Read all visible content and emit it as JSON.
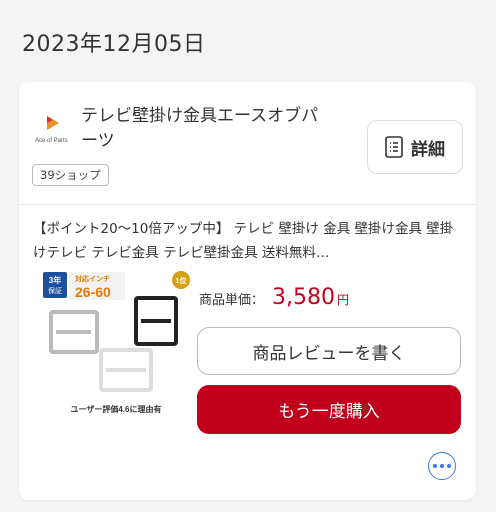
{
  "order_date": "2023年12月05日",
  "shop": {
    "name": "テレビ壁掛け金具エースオブパーツ",
    "logo_text": "Ace of Parts",
    "badge": "39ショップ",
    "detail_button": "詳細",
    "detail_icon": "list-document-icon"
  },
  "product": {
    "description": "【ポイント20〜10倍アップ中】 テレビ 壁掛け 金具 壁掛け金具 壁掛けテレビ テレビ金具 テレビ壁掛金具 送料無料…",
    "image_text": {
      "warranty_top": "3年",
      "warranty_bottom": "保証",
      "inch_label": "対応インチ",
      "inch_range": "26-60",
      "rank_badge": "1位",
      "rating_caption": "ユーザー評価4.6に理由有"
    },
    "price_label": "商品単価：",
    "price_value": "3,580",
    "price_unit": "円"
  },
  "actions": {
    "review_button": "商品レビューを書く",
    "rebuy_button": "もう一度購入",
    "more_icon": "more-horizontal-icon"
  },
  "colors": {
    "accent_red": "#c0001b",
    "price_red": "#c6001f",
    "link_blue": "#3a7ad8"
  }
}
